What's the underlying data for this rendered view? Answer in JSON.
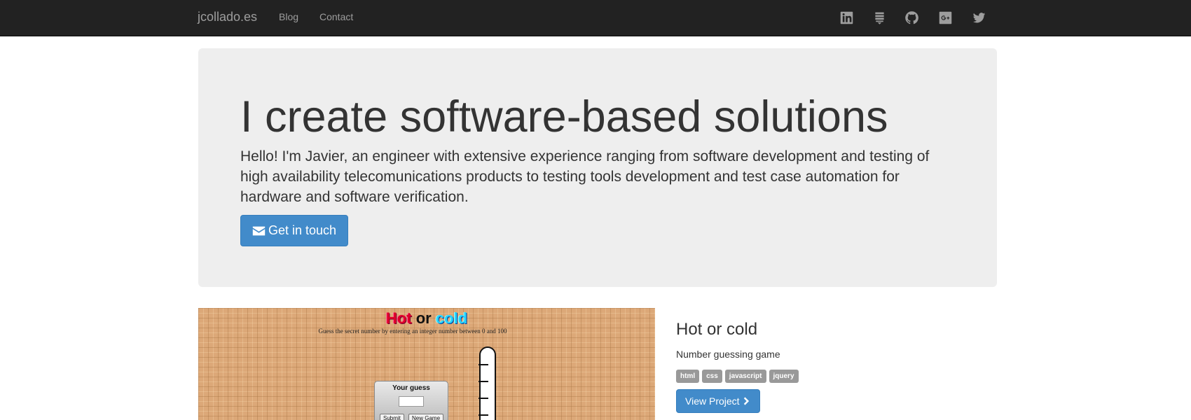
{
  "navbar": {
    "brand": "jcollado.es",
    "links": [
      "Blog",
      "Contact"
    ],
    "social": [
      "linkedin-icon",
      "stack-overflow-icon",
      "github-icon",
      "google-plus-icon",
      "twitter-icon"
    ]
  },
  "hero": {
    "title": "I create software-based solutions",
    "text": "Hello! I'm Javier, an engineer with extensive experience ranging from software development and testing of high availability telecomunications products to testing tools development and test case automation for hardware and software verification.",
    "button": "Get in touch",
    "button_icon": "envelope-icon"
  },
  "project": {
    "screenshot": {
      "title_hot": "Hot",
      "title_or": "or",
      "title_cold": "cold",
      "subtitle": "Guess the secret number by entering an integer number between 0 and 100",
      "guess_label": "Your guess",
      "submit": "Submit",
      "new_game": "New Game"
    },
    "title": "Hot or cold",
    "description": "Number guessing game",
    "tags": [
      "html",
      "css",
      "javascript",
      "jquery"
    ],
    "button": "View Project",
    "button_icon": "chevron-right-icon"
  },
  "colors": {
    "navbar_bg": "#222222",
    "jumbotron_bg": "#eeeeee",
    "primary": "#428bca",
    "label": "#999999"
  }
}
